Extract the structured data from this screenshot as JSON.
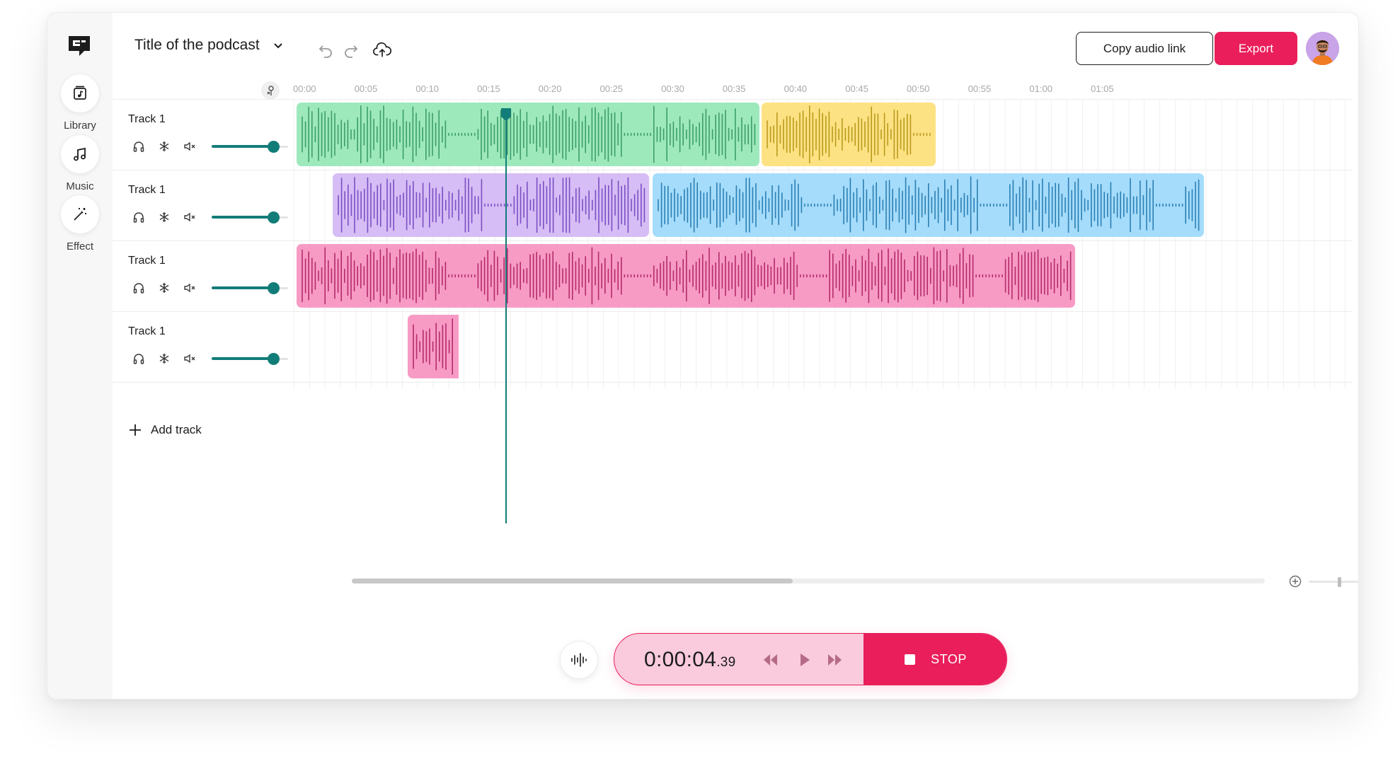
{
  "header": {
    "title": "Title of the podcast",
    "copy_label": "Copy audio link",
    "export_label": "Export",
    "icons": [
      "logo-icon",
      "chevron-down-icon",
      "undo-icon",
      "redo-icon",
      "cloud-upload-icon"
    ]
  },
  "sidebar": {
    "items": [
      {
        "label": "Library",
        "icon": "library-icon"
      },
      {
        "label": "Music",
        "icon": "music-note-icon"
      },
      {
        "label": "Effect",
        "icon": "magic-wand-icon"
      }
    ]
  },
  "ruler": {
    "ticks": [
      "00:00",
      "00:05",
      "00:10",
      "00:15",
      "00:20",
      "00:25",
      "00:30",
      "00:35",
      "00:40",
      "00:45",
      "00:50",
      "00:55",
      "01:00",
      "01:05"
    ]
  },
  "tracks": [
    {
      "name": "Track 1",
      "volume": 0.81
    },
    {
      "name": "Track 1",
      "volume": 0.81
    },
    {
      "name": "Track 1",
      "volume": 0.81
    },
    {
      "name": "Track 1",
      "volume": 0.81
    }
  ],
  "add_track_label": "Add track",
  "transport": {
    "time_main": "0:00:04",
    "time_ms": ".39",
    "stop_label": "STOP"
  },
  "colors": {
    "accent": "#e91e5a",
    "teal": "#127c78",
    "clip_green": "#9ee9bc",
    "clip_yellow": "#fde283",
    "clip_purple": "#d6bdf5",
    "clip_blue": "#a5dcfb",
    "clip_pink": "#f79bc5"
  }
}
